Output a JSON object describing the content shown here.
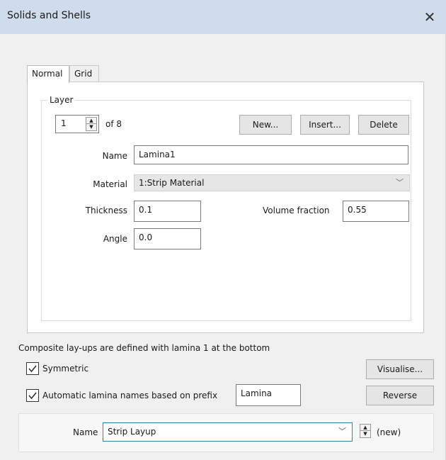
{
  "window": {
    "title": "Solids and Shells",
    "close_icon": "close-icon"
  },
  "tabs": [
    {
      "label": "Normal",
      "active": true
    },
    {
      "label": "Grid",
      "active": false
    }
  ],
  "layer": {
    "group_label": "Layer",
    "index": "1",
    "of_label": "of 8",
    "buttons": {
      "new": "New...",
      "insert": "Insert...",
      "delete": "Delete"
    },
    "name_label": "Name",
    "name_value": "Lamina1",
    "material_label": "Material",
    "material_value": "1:Strip Material",
    "thickness_label": "Thickness",
    "thickness_value": "0.1",
    "volume_fraction_label": "Volume fraction",
    "volume_fraction_value": "0.55",
    "angle_label": "Angle",
    "angle_value": "0.0"
  },
  "footer": {
    "info_text": "Composite lay-ups are defined with lamina 1 at the bottom",
    "symmetric_label": "Symmetric",
    "symmetric_checked": true,
    "visualise_button": "Visualise...",
    "auto_names_label": "Automatic lamina names based on prefix",
    "auto_names_checked": true,
    "prefix_value": "Lamina",
    "reverse_button": "Reverse",
    "layup_name_label": "Name",
    "layup_name_value": "Strip Layup",
    "layup_status": "(new)"
  },
  "colors": {
    "titlebar": "#cfdcec",
    "window_bg": "#f0f0f0",
    "focus_border": "#3c7fb1"
  }
}
